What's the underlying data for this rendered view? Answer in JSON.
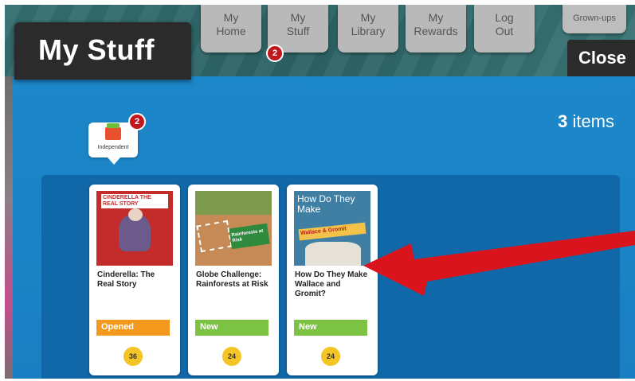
{
  "header": {
    "title": "My Stuff",
    "nav": [
      {
        "line1": "My",
        "line2": "Home"
      },
      {
        "line1": "My",
        "line2": "Stuff",
        "badge": "2"
      },
      {
        "line1": "My",
        "line2": "Library"
      },
      {
        "line1": "My",
        "line2": "Rewards"
      },
      {
        "line1": "Log",
        "line2": "Out"
      }
    ],
    "grownups_label": "Grown-ups",
    "close_label": "Close"
  },
  "panel": {
    "items_count": "3",
    "items_label": "items",
    "collection": {
      "label": "Independent",
      "badge": "2"
    }
  },
  "books": [
    {
      "title": "Cinderella: The Real Story",
      "cover_text": "CINDERELLA THE REAL STORY",
      "status": "Opened",
      "level": "36"
    },
    {
      "title": "Globe Challenge: Rainforests at Risk",
      "cover_text": "Rainforests at Risk",
      "status": "New",
      "level": "24"
    },
    {
      "title": "How Do They Make Wallace and Gromit?",
      "cover_text": "How Do They Make",
      "cover_sub": "Wallace & Gromit",
      "status": "New",
      "level": "24"
    }
  ],
  "colors": {
    "panel_blue": "#1c87c9",
    "shelf_blue": "#1168a8",
    "opened_orange": "#f39a1e",
    "new_green": "#7cc243",
    "level_yellow": "#f5c526",
    "arrow_red": "#d9141c"
  }
}
